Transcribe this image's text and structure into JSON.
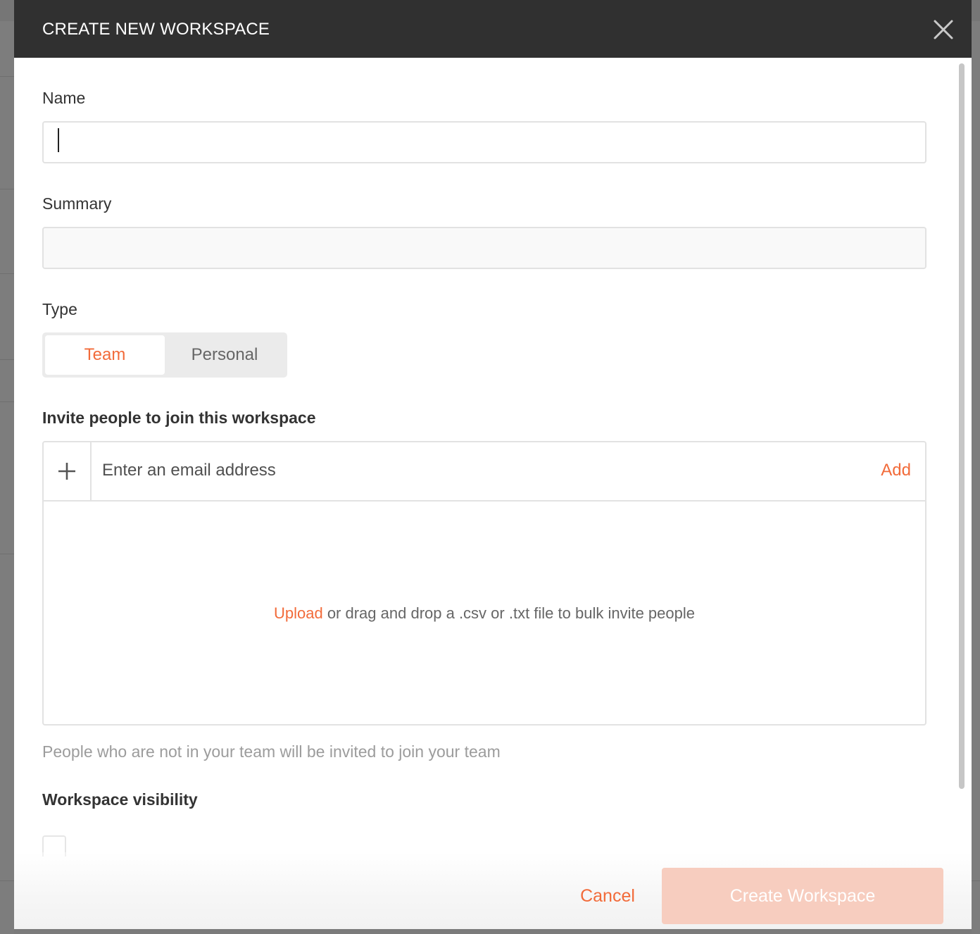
{
  "modal": {
    "title": "CREATE NEW WORKSPACE",
    "close_icon": "close-icon"
  },
  "form": {
    "name_label": "Name",
    "name_value": "",
    "summary_label": "Summary",
    "summary_value": "",
    "type_label": "Type",
    "type_options": [
      {
        "label": "Team",
        "selected": true
      },
      {
        "label": "Personal",
        "selected": false
      }
    ],
    "invite_heading": "Invite people to join this workspace",
    "invite_plus_icon": "plus-icon",
    "email_placeholder": "Enter an email address",
    "add_label": "Add",
    "upload_link": "Upload",
    "dropzone_text": " or drag and drop a .csv or .txt file to bulk invite people",
    "invite_note": "People who are not in your team will be invited to join your team",
    "visibility_heading": "Workspace visibility"
  },
  "footer": {
    "cancel_label": "Cancel",
    "create_label": "Create Workspace"
  },
  "colors": {
    "accent": "#f26b3a",
    "header_bg": "#303030",
    "disabled_button": "#f7cdbf"
  }
}
